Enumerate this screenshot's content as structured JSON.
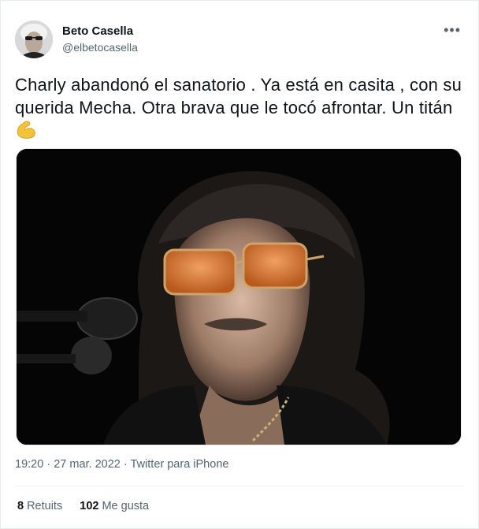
{
  "user": {
    "display_name": "Beto Casella",
    "handle": "@elbetocasella"
  },
  "tweet": {
    "text": "Charly abandonó el sanatorio . Ya está en casita , con su querida Mecha. Otra brava que le tocó afrontar. Un titán",
    "emoji": "flexed-biceps",
    "media_alt": "Photo of a musician with curly hair and orange-tinted sunglasses next to a microphone"
  },
  "meta": {
    "time": "19:20",
    "date": "27 mar. 2022",
    "separator1": "·",
    "separator2": "·",
    "source": "Twitter para iPhone"
  },
  "stats": {
    "retweets_count": "8",
    "retweets_label": "Retuits",
    "likes_count": "102",
    "likes_label": "Me gusta"
  },
  "icons": {
    "more": "more-options-icon"
  }
}
